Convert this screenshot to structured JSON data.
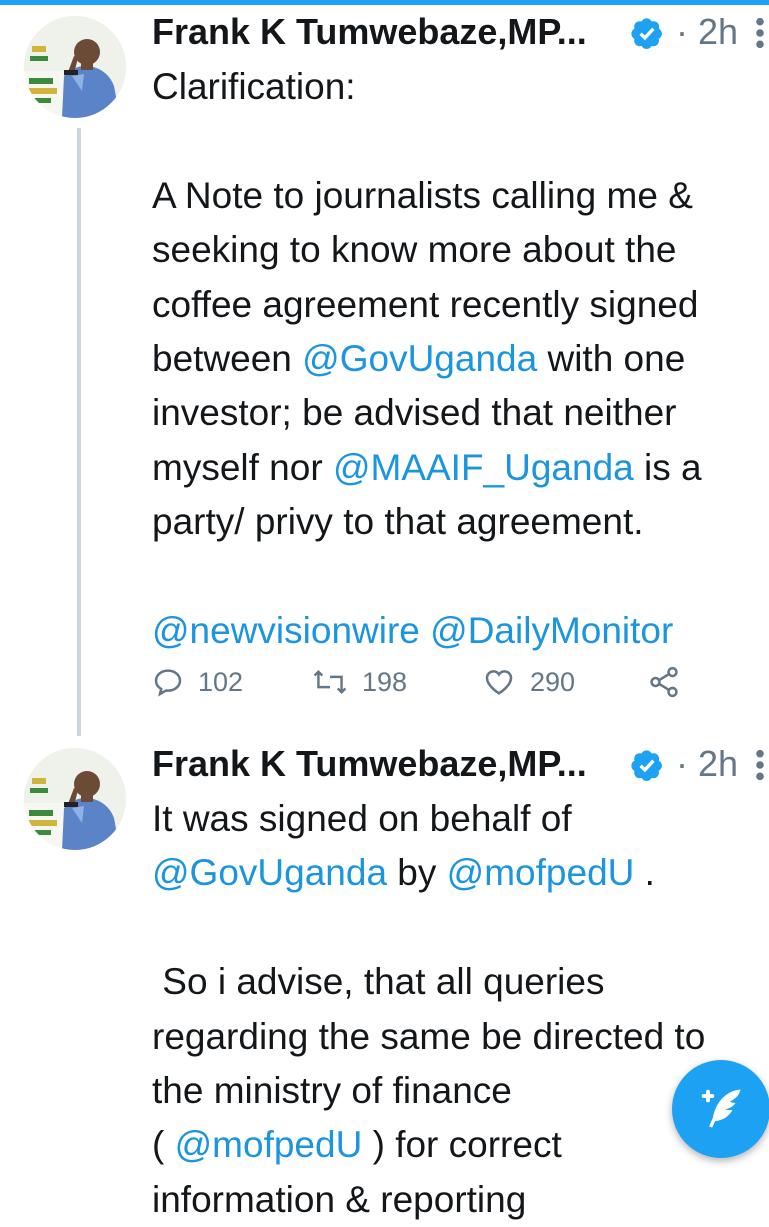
{
  "thread": [
    {
      "author": "Frank K Tumwebaze,MP...",
      "verified": true,
      "time_sep": "·",
      "time": "2h",
      "body_lines": [
        [
          {
            "t": "Clarification:"
          }
        ],
        [
          {
            "t": ""
          }
        ],
        [
          {
            "t": "A Note to journalists calling me &"
          }
        ],
        [
          {
            "t": "seeking to know more about the"
          }
        ],
        [
          {
            "t": "coffee agreement recently signed"
          }
        ],
        [
          {
            "t": "between "
          },
          {
            "t": "@GovUganda",
            "m": true
          },
          {
            "t": " with one"
          }
        ],
        [
          {
            "t": "investor; be advised that neither"
          }
        ],
        [
          {
            "t": "myself nor "
          },
          {
            "t": "@MAAIF_Uganda",
            "m": true
          },
          {
            "t": " is a"
          }
        ],
        [
          {
            "t": "party/ privy to that agreement."
          }
        ],
        [
          {
            "t": ""
          }
        ],
        [
          {
            "t": "@newvisionwire",
            "m": true
          },
          {
            "t": " "
          },
          {
            "t": "@DailyMonitor",
            "m": true
          }
        ]
      ],
      "stats": {
        "replies": "102",
        "retweets": "198",
        "likes": "290"
      }
    },
    {
      "author": "Frank K Tumwebaze,MP...",
      "verified": true,
      "time_sep": "·",
      "time": "2h",
      "body_lines": [
        [
          {
            "t": "It was signed on behalf of"
          }
        ],
        [
          {
            "t": "@GovUganda",
            "m": true
          },
          {
            "t": " by "
          },
          {
            "t": "@mofpedU",
            "m": true
          },
          {
            "t": " ."
          }
        ],
        [
          {
            "t": ""
          }
        ],
        [
          {
            "t": " So i advise, that all queries"
          }
        ],
        [
          {
            "t": "regarding the same be directed to"
          }
        ],
        [
          {
            "t": "the ministry of finance"
          }
        ],
        [
          {
            "t": "( "
          },
          {
            "t": "@mofpedU",
            "m": true
          },
          {
            "t": " ) for correct"
          }
        ],
        [
          {
            "t": "information & reporting"
          }
        ]
      ]
    }
  ],
  "icons": {
    "verified": "verified-badge-icon",
    "reply": "reply-icon",
    "retweet": "retweet-icon",
    "like": "heart-icon",
    "share": "share-icon",
    "more": "more-vertical-icon",
    "compose": "compose-feather-icon"
  },
  "colors": {
    "accent": "#1da1f2",
    "mention": "#1b95e0",
    "muted": "#657786",
    "text": "#14171a"
  }
}
